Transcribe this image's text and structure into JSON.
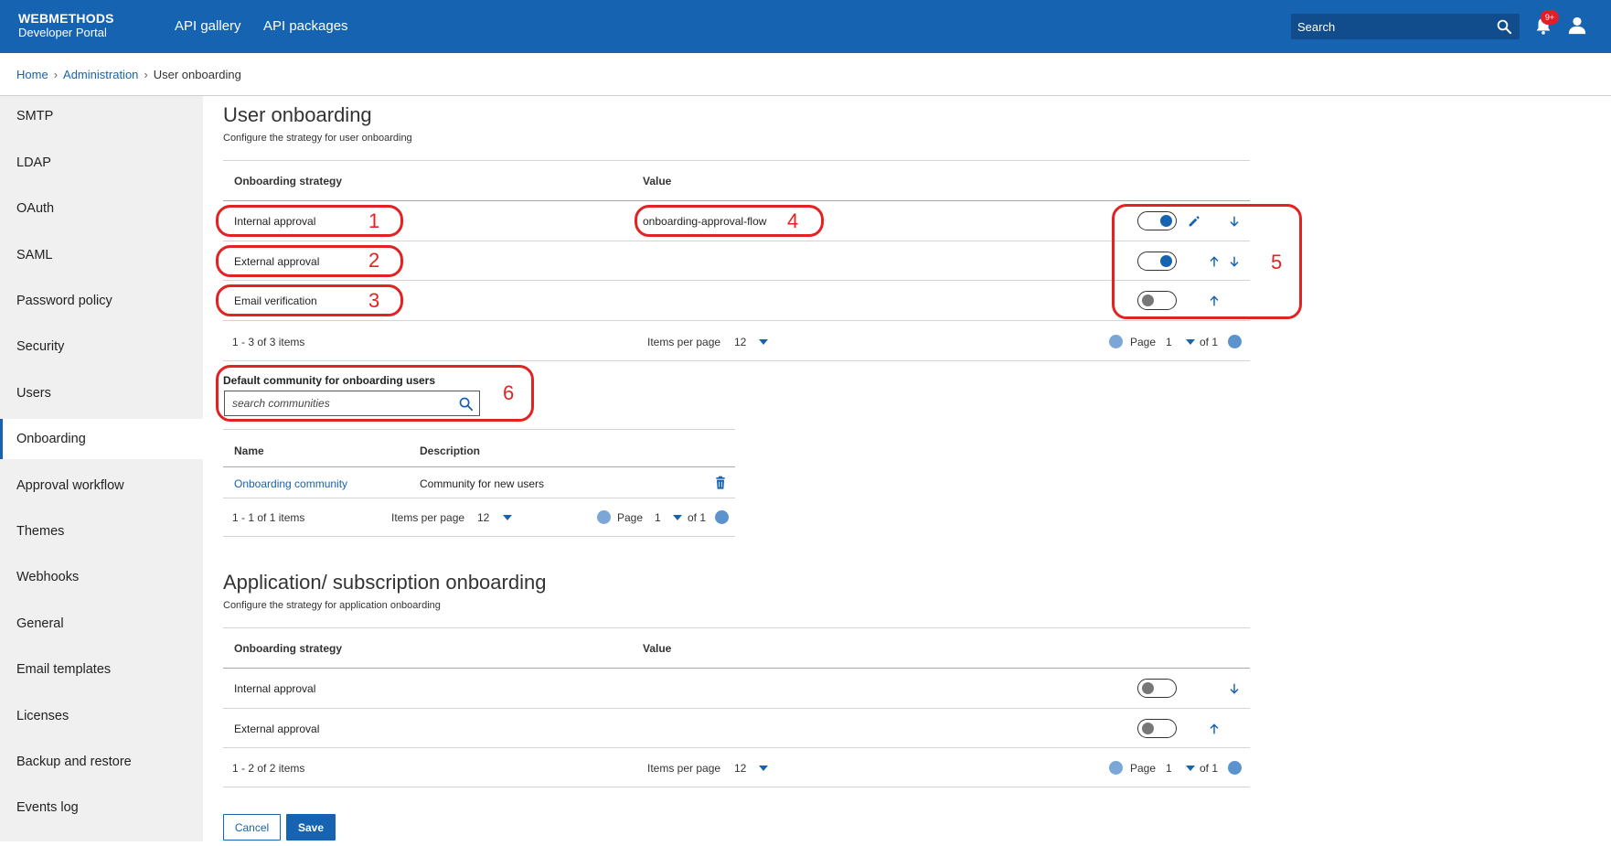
{
  "header": {
    "logo_line1": "WEBMETHODS",
    "logo_line2": "Developer Portal",
    "nav": [
      "API gallery",
      "API packages"
    ],
    "search_placeholder": "Search",
    "notification_badge": "9+",
    "brand_color": "#1663b1"
  },
  "breadcrumb": {
    "items": [
      "Home",
      "Administration",
      "User onboarding"
    ]
  },
  "sidebar": {
    "items": [
      "SMTP",
      "LDAP",
      "OAuth",
      "SAML",
      "Password policy",
      "Security",
      "Users",
      "Onboarding",
      "Approval workflow",
      "Themes",
      "Webhooks",
      "General",
      "Email templates",
      "Licenses",
      "Backup and restore",
      "Events log"
    ],
    "active": "Onboarding"
  },
  "user_onboarding": {
    "title": "User onboarding",
    "subtitle": "Configure the strategy for user onboarding",
    "columns": [
      "Onboarding strategy",
      "Value"
    ],
    "rows": [
      {
        "strategy": "Internal approval",
        "value": "onboarding-approval-flow",
        "enabled": true,
        "actions": [
          "edit",
          "down"
        ]
      },
      {
        "strategy": "External approval",
        "value": "",
        "enabled": true,
        "actions": [
          "up",
          "down"
        ]
      },
      {
        "strategy": "Email verification",
        "value": "",
        "enabled": false,
        "actions": [
          "up"
        ]
      }
    ],
    "pager": {
      "summary": "1 - 3 of 3 items",
      "items_per_page_label": "Items per page",
      "items_per_page": "12",
      "page_label": "Page",
      "page": "1",
      "of": "of 1"
    }
  },
  "community": {
    "label": "Default community for onboarding users",
    "placeholder": "search communities",
    "columns": [
      "Name",
      "Description"
    ],
    "rows": [
      {
        "name": "Onboarding community",
        "description": "Community for new users"
      }
    ],
    "pager": {
      "summary": "1 - 1 of 1 items",
      "items_per_page_label": "Items per page",
      "items_per_page": "12",
      "page_label": "Page",
      "page": "1",
      "of": "of 1"
    }
  },
  "app_onboarding": {
    "title": "Application/ subscription onboarding",
    "subtitle": "Configure the strategy for application onboarding",
    "columns": [
      "Onboarding strategy",
      "Value"
    ],
    "rows": [
      {
        "strategy": "Internal approval",
        "value": "",
        "enabled": false,
        "actions": [
          "down"
        ]
      },
      {
        "strategy": "External approval",
        "value": "",
        "enabled": false,
        "actions": [
          "up"
        ]
      }
    ],
    "pager": {
      "summary": "1 - 2 of 2 items",
      "items_per_page_label": "Items per page",
      "items_per_page": "12",
      "page_label": "Page",
      "page": "1",
      "of": "of 1"
    }
  },
  "buttons": {
    "cancel": "Cancel",
    "save": "Save"
  },
  "annotations": {
    "labels": [
      "1",
      "2",
      "3",
      "4",
      "5",
      "6"
    ],
    "color": "#e32222"
  }
}
